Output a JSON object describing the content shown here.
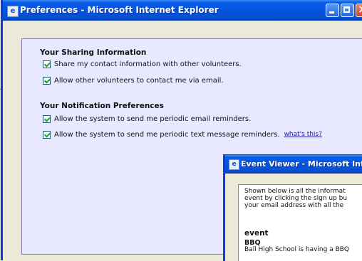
{
  "preferences_window": {
    "title": "Preferences - Microsoft Internet Explorer",
    "sharing": {
      "heading": "Your Sharing Information",
      "options": [
        {
          "label": "Share my contact information with other volunteers.",
          "checked": true
        },
        {
          "label": "Allow other volunteers to contact me via email.",
          "checked": true
        }
      ]
    },
    "notifications": {
      "heading": "Your Notification Preferences",
      "options": [
        {
          "label": "Allow the system to send me periodic email reminders.",
          "checked": true
        },
        {
          "label": "Allow the system to send me periodic text message reminders.",
          "checked": true,
          "link": "what's this?"
        }
      ]
    }
  },
  "event_viewer_window": {
    "title": "Event Viewer - Microsoft Inter",
    "intro_lines": [
      "Shown below is all the informat",
      "event by clicking the sign up bu",
      "your email address with all the"
    ],
    "event_label": "event",
    "event_name": "BBQ",
    "event_description": "Ball High School is having a BBQ"
  },
  "colors": {
    "titlebar": "#0656e0",
    "panel_bg": "#e8e8ff",
    "checkmark": "#21a121",
    "link": "#1a1ab0"
  }
}
